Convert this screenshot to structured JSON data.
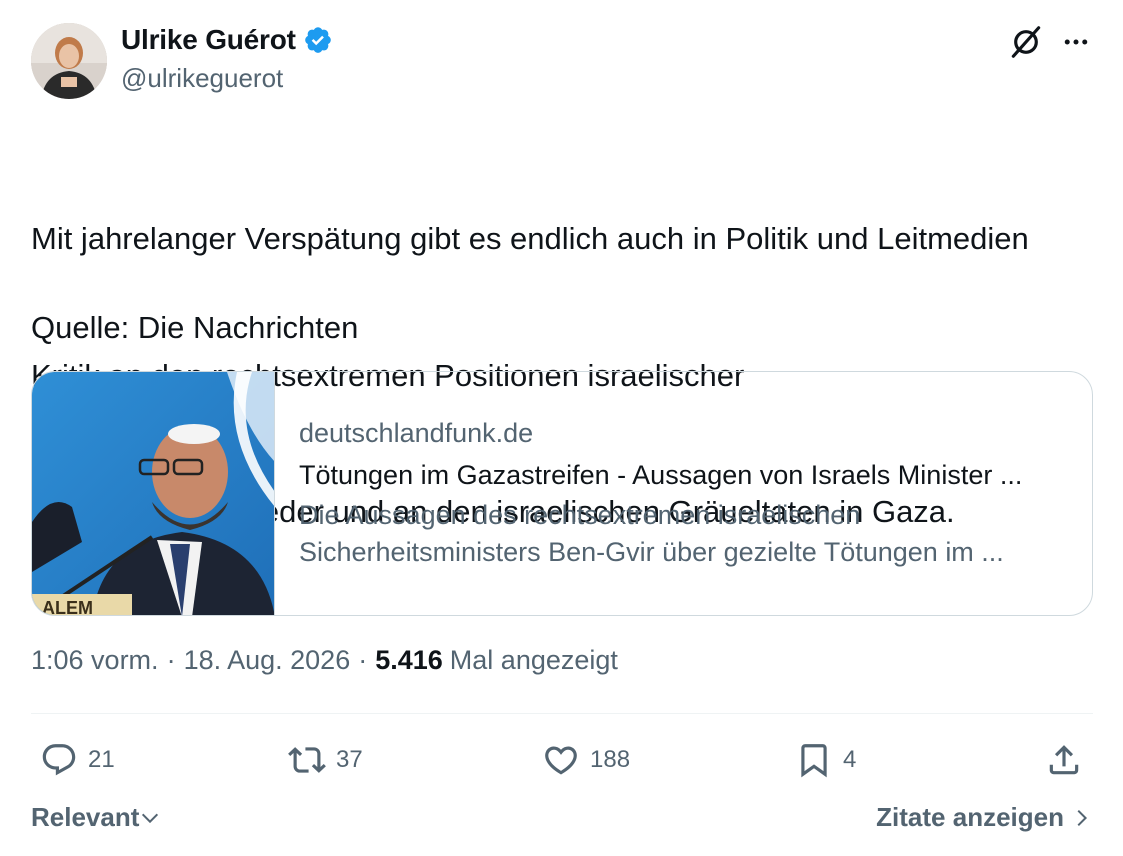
{
  "author": {
    "display_name": "Ulrike Guérot",
    "handle": "@ulrikeguerot",
    "verified": true
  },
  "tweet": {
    "text_lines": [
      "Mit jahrelanger Verspätung gibt es endlich auch in Politik und Leitmedien",
      "Kritik an den rechtsextremen Positionen israelischer",
      "Regierungsmitglieder und an den israelischen Gräueltaten in Gaza."
    ],
    "source_line": "Quelle: Die Nachrichten"
  },
  "card": {
    "domain": "deutschlandfunk.de",
    "title": "Tötungen im Gazastreifen - Aussagen von Israels Minister ...",
    "desc_line1": "Die Aussagen des rechtsextremen israelischen",
    "desc_line2": "Sicherheitsministers Ben-Gvir über gezielte Tötungen im ...",
    "image_sign_text": "ALEM"
  },
  "meta": {
    "time": "1:06 vorm.",
    "date": "18. Aug. 2026",
    "separator": "·",
    "views_count": "5.416",
    "views_label": "Mal angezeigt"
  },
  "actions": {
    "replies": "21",
    "reposts": "37",
    "likes": "188",
    "bookmarks": "4"
  },
  "footer": {
    "sort_label": "Relevant",
    "quotes_label": "Zitate anzeigen"
  },
  "colors": {
    "text": "#0f1419",
    "secondary": "#536471",
    "verified": "#1d9bf0",
    "border": "#cfd9de"
  },
  "icons": [
    "grok-icon",
    "more-icon",
    "verified-badge-icon",
    "reply-icon",
    "repost-icon",
    "like-icon",
    "bookmark-icon",
    "share-icon",
    "chevron-down-icon",
    "chevron-right-icon"
  ]
}
